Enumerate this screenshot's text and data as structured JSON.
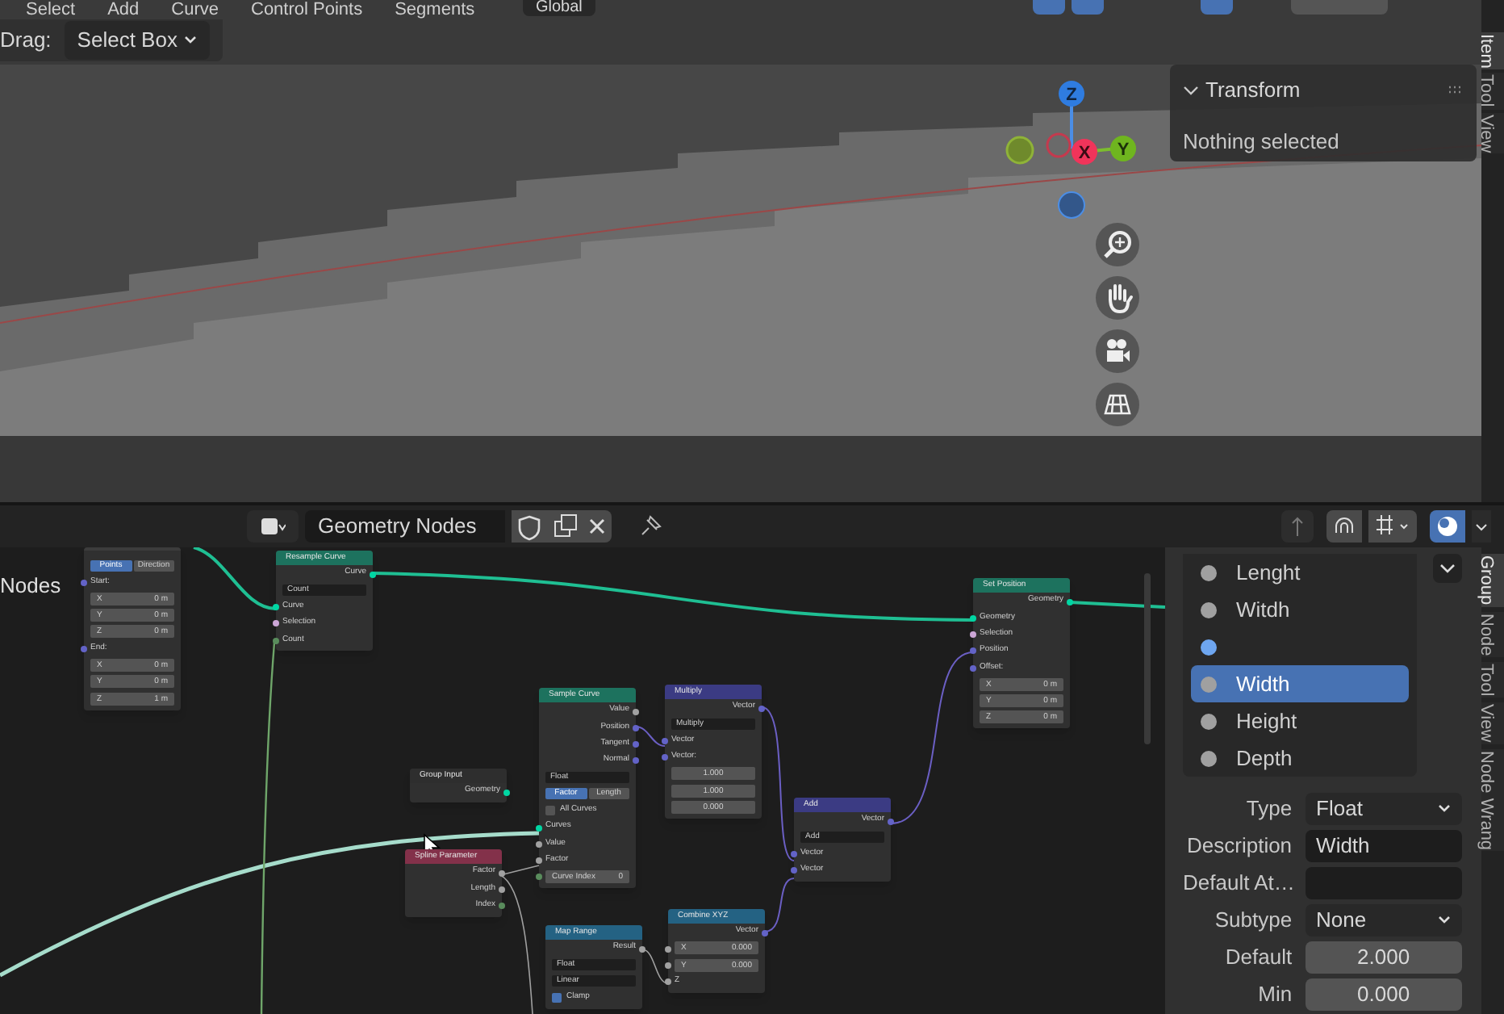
{
  "menu": [
    "Select",
    "Add",
    "Curve",
    "Control Points",
    "Segments"
  ],
  "transform_orientation": "Global",
  "tool_header": {
    "label": "Drag:",
    "value": "Select Box"
  },
  "viewport": {
    "gizmo": {
      "z": "Z",
      "x": "X",
      "y": "Y"
    },
    "transform_panel": {
      "title": "Transform",
      "message": "Nothing selected"
    },
    "side_tabs": [
      {
        "label": "Item",
        "selected": true
      },
      {
        "label": "Tool",
        "selected": false
      },
      {
        "label": "View",
        "selected": false
      }
    ]
  },
  "node_header": {
    "editor_name": "Geometry Nodes"
  },
  "canvas": {
    "region_label": "Nodes",
    "nodes": [
      {
        "color": "#3c3c3c",
        "rows": [
          {
            "kind": "toggle",
            "options": [
              {
                "label": "Points",
                "selected": true
              },
              {
                "label": "Direction",
                "selected": false
              }
            ]
          },
          {
            "kind": "input",
            "label": "Start:",
            "color": "#6363c7"
          },
          {
            "kind": "field",
            "label": "X",
            "value": "0 m"
          },
          {
            "kind": "field",
            "label": "Y",
            "value": "0 m"
          },
          {
            "kind": "field",
            "label": "Z",
            "value": "0 m"
          },
          {
            "kind": "input",
            "label": "End:",
            "color": "#6363c7"
          },
          {
            "kind": "field",
            "label": "X",
            "value": "0 m"
          },
          {
            "kind": "field",
            "label": "Y",
            "value": "0 m"
          },
          {
            "kind": "field",
            "label": "Z",
            "value": "1 m"
          }
        ]
      },
      {
        "title": "Resample Curve",
        "color": "#1d725e",
        "rows": [
          {
            "kind": "output",
            "label": "Curve",
            "color": "#00d6a3"
          },
          {
            "kind": "dropdown",
            "label": "Count"
          },
          {
            "kind": "input",
            "label": "Curve",
            "color": "#00d6a3"
          },
          {
            "kind": "input",
            "label": "Selection",
            "color": "#cca6d6"
          },
          {
            "kind": "input",
            "label": "Count",
            "color": "#598c5c"
          }
        ]
      },
      {
        "title": "Group Input",
        "color": "#2e2e2e",
        "rows": [
          {
            "kind": "output",
            "label": "Geometry",
            "color": "#00d6a3"
          }
        ]
      },
      {
        "title": "Spline Parameter",
        "color": "#83314a",
        "rows": [
          {
            "kind": "output",
            "label": "Factor",
            "color": "#a1a1a1"
          },
          {
            "kind": "output",
            "label": "Length",
            "color": "#a1a1a1"
          },
          {
            "kind": "output",
            "label": "Index",
            "color": "#598c5c"
          }
        ]
      },
      {
        "title": "Sample Curve",
        "color": "#1d725e",
        "rows": [
          {
            "kind": "output",
            "label": "Value",
            "color": "#a1a1a1"
          },
          {
            "kind": "output",
            "label": "Position",
            "color": "#6363c7"
          },
          {
            "kind": "output",
            "label": "Tangent",
            "color": "#6363c7"
          },
          {
            "kind": "output",
            "label": "Normal",
            "color": "#6363c7"
          },
          {
            "kind": "dropdown",
            "label": "Float"
          },
          {
            "kind": "toggle",
            "options": [
              {
                "label": "Factor",
                "selected": true
              },
              {
                "label": "Length",
                "selected": false
              }
            ]
          },
          {
            "kind": "checkbox",
            "label": "All Curves",
            "checked": false
          },
          {
            "kind": "input",
            "label": "Curves",
            "color": "#00d6a3"
          },
          {
            "kind": "input",
            "label": "Value",
            "color": "#a1a1a1"
          },
          {
            "kind": "input",
            "label": "Factor",
            "color": "#a1a1a1"
          },
          {
            "kind": "field",
            "label": "Curve Index",
            "value": "0",
            "color": "#598c5c"
          }
        ]
      },
      {
        "title": "Multiply",
        "color": "#3b3b83",
        "rows": [
          {
            "kind": "output",
            "label": "Vector",
            "color": "#6363c7"
          },
          {
            "kind": "dropdown",
            "label": "Multiply"
          },
          {
            "kind": "input",
            "label": "Vector",
            "color": "#6363c7"
          },
          {
            "kind": "input",
            "label": "Vector:",
            "color": "#6363c7"
          },
          {
            "kind": "value",
            "value": "1.000"
          },
          {
            "kind": "value",
            "value": "1.000"
          },
          {
            "kind": "value",
            "value": "0.000"
          }
        ]
      },
      {
        "title": "Add",
        "color": "#3b3b83",
        "rows": [
          {
            "kind": "output",
            "label": "Vector",
            "color": "#6363c7"
          },
          {
            "kind": "dropdown",
            "label": "Add"
          },
          {
            "kind": "input",
            "label": "Vector",
            "color": "#6363c7"
          },
          {
            "kind": "input",
            "label": "Vector",
            "color": "#6363c7"
          }
        ]
      },
      {
        "title": "Set Position",
        "color": "#1d725e",
        "rows": [
          {
            "kind": "output",
            "label": "Geometry",
            "color": "#00d6a3"
          },
          {
            "kind": "input",
            "label": "Geometry",
            "color": "#00d6a3"
          },
          {
            "kind": "input",
            "label": "Selection",
            "color": "#cca6d6"
          },
          {
            "kind": "input",
            "label": "Position",
            "color": "#6363c7"
          },
          {
            "kind": "input",
            "label": "Offset:",
            "color": "#6363c7"
          },
          {
            "kind": "field",
            "label": "X",
            "value": "0 m"
          },
          {
            "kind": "field",
            "label": "Y",
            "value": "0 m"
          },
          {
            "kind": "field",
            "label": "Z",
            "value": "0 m"
          }
        ]
      },
      {
        "title": "Map Range",
        "color": "#246283",
        "rows": [
          {
            "kind": "output",
            "label": "Result",
            "color": "#a1a1a1"
          },
          {
            "kind": "dropdown",
            "label": "Float"
          },
          {
            "kind": "dropdown",
            "label": "Linear"
          },
          {
            "kind": "checkbox",
            "label": "Clamp",
            "checked": true
          }
        ]
      },
      {
        "title": "Combine XYZ",
        "color": "#246283",
        "rows": [
          {
            "kind": "output",
            "label": "Vector",
            "color": "#6363c7"
          },
          {
            "kind": "field",
            "label": "X",
            "value": "0.000",
            "color": "#a1a1a1"
          },
          {
            "kind": "field",
            "label": "Y",
            "value": "0.000",
            "color": "#a1a1a1"
          },
          {
            "kind": "input",
            "label": "Z",
            "color": "#a1a1a1"
          }
        ]
      }
    ]
  },
  "sidebar": {
    "items": [
      {
        "label": "Lenght",
        "selected": false,
        "color": "#a0a0a0"
      },
      {
        "label": "Witdh",
        "selected": false,
        "color": "#a0a0a0"
      },
      {
        "selected": false,
        "color": "#6ea6f0"
      },
      {
        "label": "Width",
        "selected": true,
        "color": "#a0a0a0"
      },
      {
        "label": "Height",
        "selected": false,
        "color": "#a0a0a0"
      },
      {
        "label": "Depth",
        "selected": false,
        "color": "#a0a0a0"
      }
    ],
    "properties": [
      {
        "kind": "dropdown",
        "label": "Type",
        "value": "Float"
      },
      {
        "kind": "text",
        "label": "Description",
        "value": "Width"
      },
      {
        "kind": "text",
        "label": "Default At…"
      },
      {
        "kind": "dropdown",
        "label": "Subtype",
        "value": "None"
      },
      {
        "kind": "number",
        "label": "Default",
        "value": "2.000"
      },
      {
        "kind": "number",
        "label": "Min",
        "value": "0.000"
      }
    ],
    "tabs": [
      {
        "label": "Group",
        "selected": true
      },
      {
        "label": "Node",
        "selected": false
      },
      {
        "label": "Tool",
        "selected": false
      },
      {
        "label": "View",
        "selected": false
      },
      {
        "label": "Node Wrang",
        "selected": false
      }
    ]
  }
}
